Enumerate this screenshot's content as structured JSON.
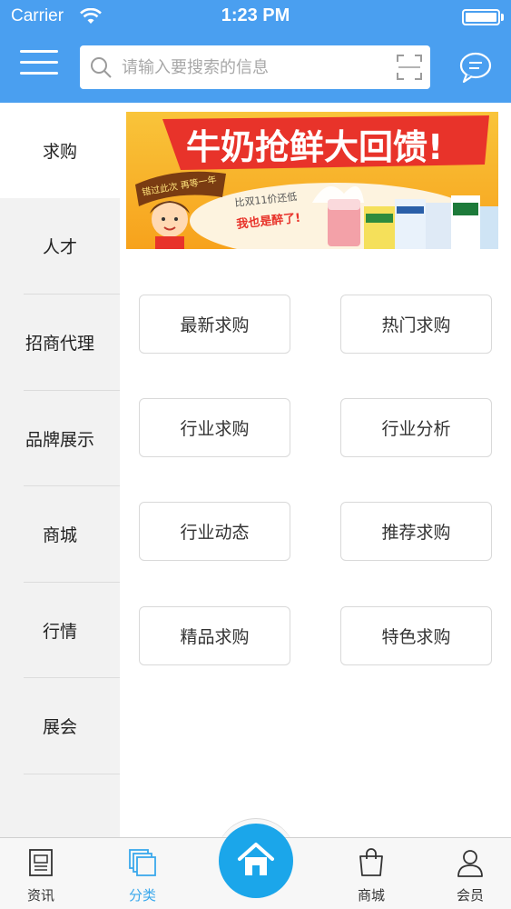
{
  "status_bar": {
    "carrier": "Carrier",
    "time": "1:23 PM",
    "battery_level": 1.0
  },
  "header": {
    "menu_icon": "hamburger-menu-icon",
    "search": {
      "placeholder": "请输入要搜索的信息",
      "value": "",
      "icon": "search-icon",
      "scan_icon": "scan-icon"
    },
    "message_icon": "chat-bubble-icon",
    "background_color": "#4a9ff0"
  },
  "sidebar": {
    "items": [
      {
        "label": "求购",
        "active": true
      },
      {
        "label": "人才",
        "active": false
      },
      {
        "label": "招商代理",
        "active": false
      },
      {
        "label": "品牌展示",
        "active": false
      },
      {
        "label": "商城",
        "active": false
      },
      {
        "label": "行情",
        "active": false
      },
      {
        "label": "展会",
        "active": false
      }
    ]
  },
  "banner": {
    "headline": "牛奶抢鲜大回馈!",
    "ribbon_text": "错过此次 再等一年",
    "sub_text_1": "比双11价还低",
    "sub_text_2": "我也是醉了!"
  },
  "grid": {
    "buttons": [
      {
        "label": "最新求购"
      },
      {
        "label": "热门求购"
      },
      {
        "label": "行业求购"
      },
      {
        "label": "行业分析"
      },
      {
        "label": "行业动态"
      },
      {
        "label": "推荐求购"
      },
      {
        "label": "精品求购"
      },
      {
        "label": "特色求购"
      }
    ]
  },
  "tabbar": {
    "tabs": [
      {
        "label": "资讯",
        "icon": "news-icon",
        "active": false
      },
      {
        "label": "分类",
        "icon": "category-icon",
        "active": true
      },
      {
        "label": "",
        "icon": "home-icon",
        "active": false
      },
      {
        "label": "商城",
        "icon": "shopping-bag-icon",
        "active": false
      },
      {
        "label": "会员",
        "icon": "user-icon",
        "active": false
      }
    ],
    "active_color": "#3aa8ec",
    "home_color": "#1ba6ea"
  }
}
